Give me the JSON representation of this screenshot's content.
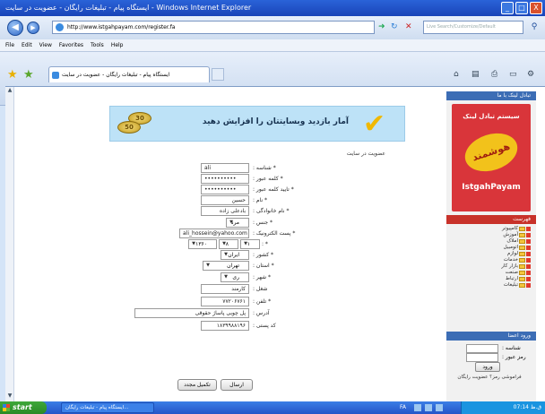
{
  "window": {
    "title": "ایستگاه پیام - تبلیغات رایگان - عضویت در سایت - Windows Internet Explorer",
    "min": "_",
    "max": "□",
    "close": "X"
  },
  "address": {
    "url": "http://www.istgahpayam.com/register.fa",
    "search_placeholder": "Live Search/Customize/Default"
  },
  "menu": [
    "File",
    "Edit",
    "View",
    "Favorites",
    "Tools",
    "Help"
  ],
  "tab": {
    "label": "ایستگاه پیام - تبلیغات رایگان - عضویت در سایت"
  },
  "banner": {
    "text": "آمار بازدید وبسایتتان را افزایش دهید",
    "coin1": "30",
    "coin2": "50"
  },
  "form": {
    "title": "عضویت در سایت",
    "fields": [
      {
        "label": "* شناسه :",
        "value": "ali"
      },
      {
        "label": "* کلمه عبور :",
        "value": "••••••••••"
      },
      {
        "label": "* تایید کلمه عبور :",
        "value": "••••••••••"
      },
      {
        "label": "* نام :",
        "value": "حسین"
      },
      {
        "label": "* نام خانوادگی :",
        "value": "بادعلی زاده"
      },
      {
        "label": "* جنس :",
        "value": "مرد"
      },
      {
        "label": "* پست الکترونیک :",
        "value": "ali_hossein@yahoo.com"
      },
      {
        "label": "* :",
        "day": "۰۱",
        "month": "۰۸",
        "year": "۱۳۶۰"
      },
      {
        "label": "* کشور :",
        "value": "ایران"
      },
      {
        "label": "* استان :",
        "value": "تهران"
      },
      {
        "label": "* شهر :",
        "value": "ری"
      },
      {
        "label": "شغل :",
        "value": "کارمند"
      },
      {
        "label": "* تلفن :",
        "value": "۷۷۲۰۶۷۶۱"
      },
      {
        "label": "آدرس :",
        "value": "پل چوبی پاساژ حقوقی"
      },
      {
        "label": "کد پستی :",
        "value": "۱۸۳۹۹۸۸۱۹۶"
      }
    ],
    "submit": "ارسال",
    "reset": "تکمیل مجدد"
  },
  "sidebar": {
    "exchange_header": "تبادل لینک با ما",
    "logo_top": "سیستم تبادل لینک",
    "logo_mid": "هوشمند",
    "logo_bottom": "IstgahPayam",
    "categories_header": "فهرست",
    "categories": [
      "کامپیوتر",
      "آموزش",
      "املاک",
      "اتومبیل",
      "لوازم",
      "خدمات",
      "بازار کار",
      "صنعت",
      "ارتباط",
      "تبلیغات"
    ],
    "login_header": "ورود اعضا",
    "login_user_label": "شناسه :",
    "login_pass_label": "رمز عبور :",
    "login_button": "ورود",
    "forgot": "فراموشی رمز؟ عضویت رایگان"
  },
  "taskbar": {
    "start": "start",
    "item": "ایستگاه پیام - تبلیغات رایگان...",
    "lang": "FA",
    "clock": "07:14 ق.ظ"
  }
}
